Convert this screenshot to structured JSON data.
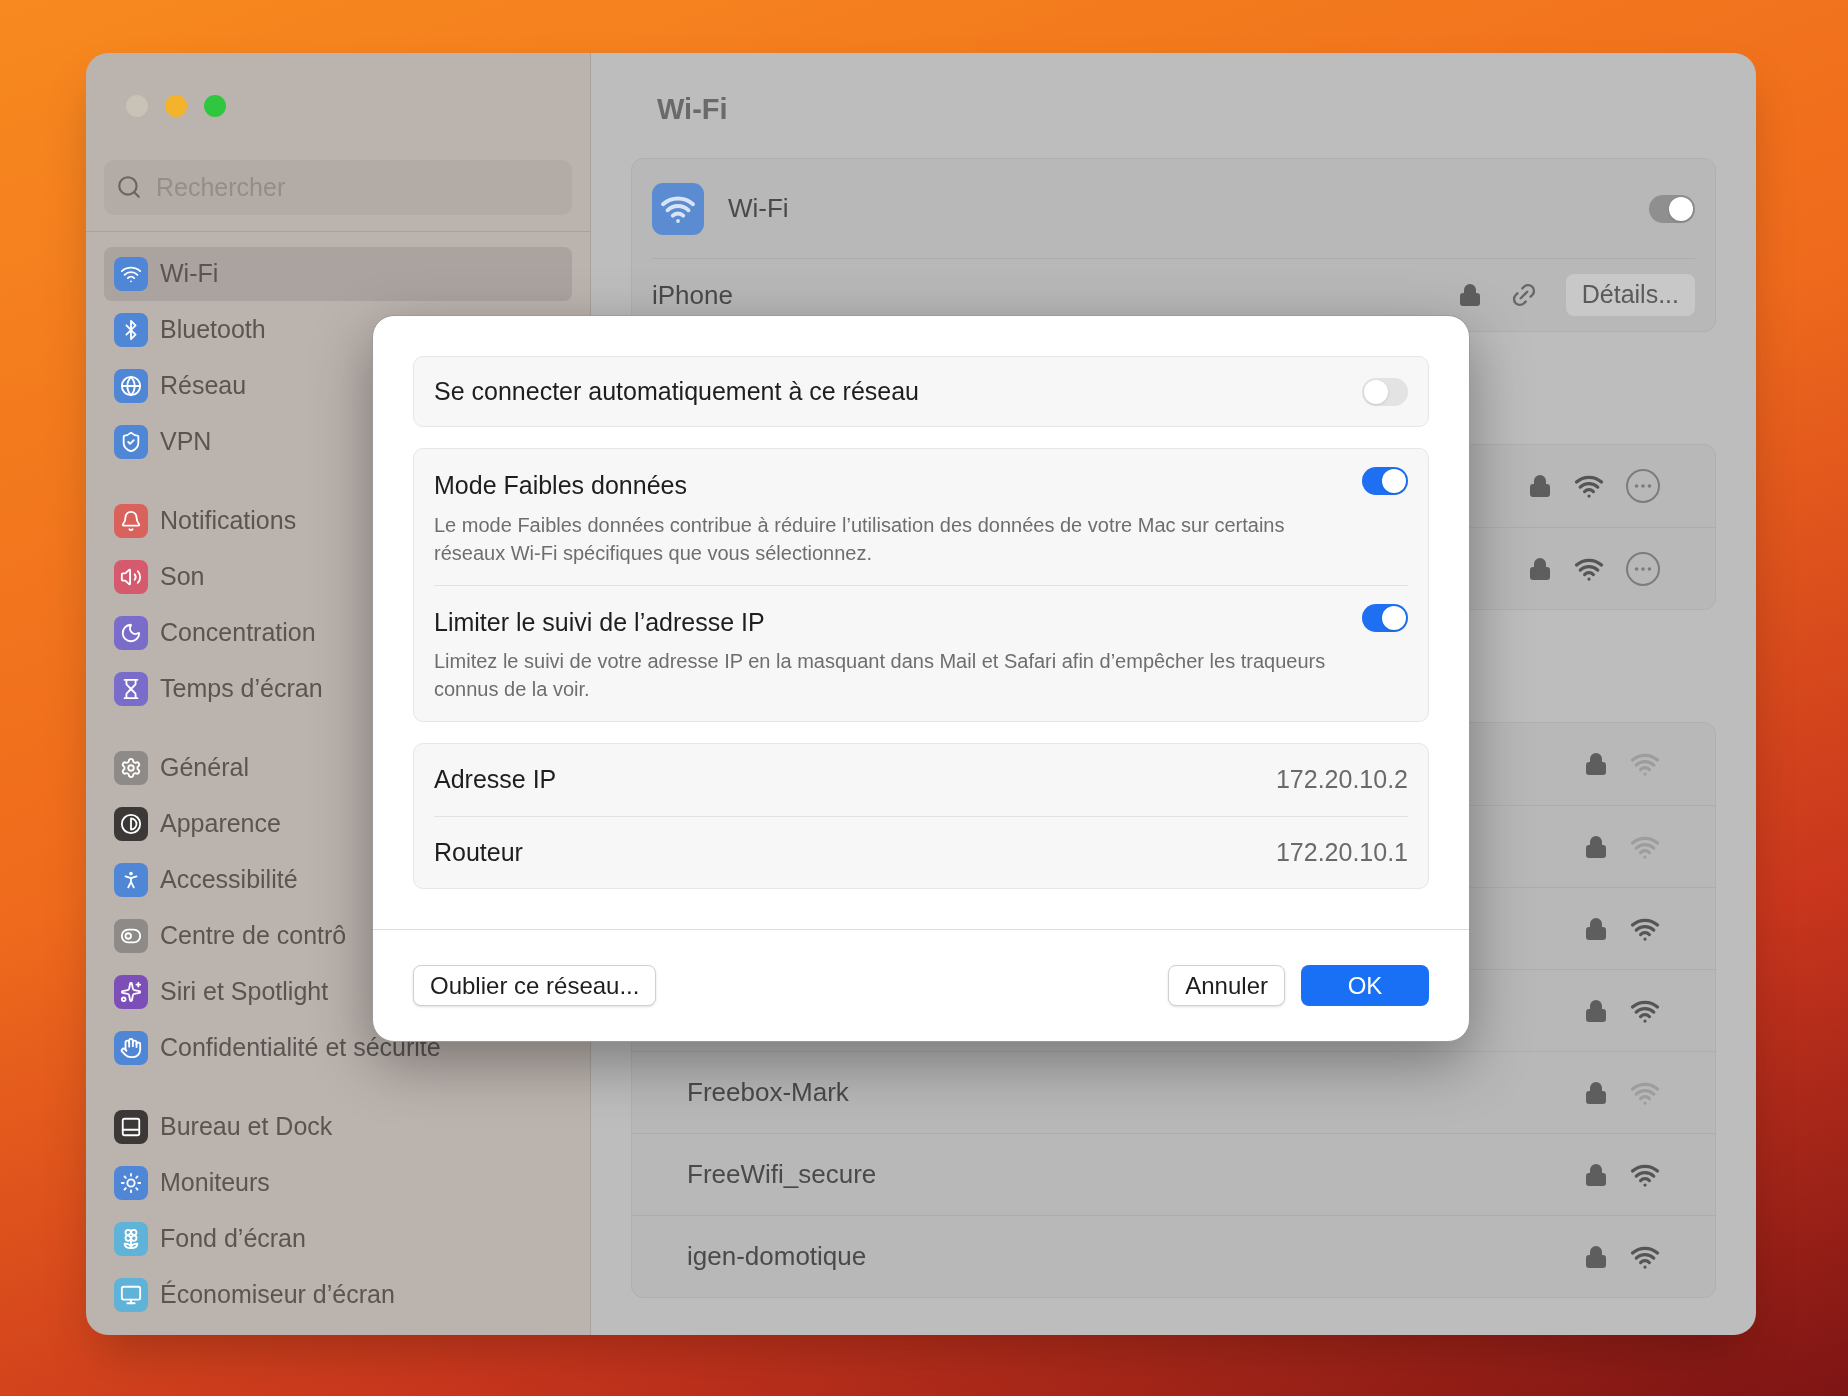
{
  "window": {
    "controls": [
      {
        "kind": "close"
      },
      {
        "kind": "minimize"
      },
      {
        "kind": "zoom"
      }
    ]
  },
  "sidebar": {
    "search": {
      "placeholder": "Rechercher"
    },
    "groups": [
      {
        "items": [
          {
            "label": "Wi-Fi",
            "selected": true
          },
          {
            "label": "Bluetooth",
            "selected": false
          },
          {
            "label": "Réseau",
            "selected": false
          },
          {
            "label": "VPN",
            "selected": false
          }
        ]
      },
      {
        "items": [
          {
            "label": "Notifications",
            "selected": false
          },
          {
            "label": "Son",
            "selected": false
          },
          {
            "label": "Concentration",
            "selected": false
          },
          {
            "label": "Temps d’écran",
            "selected": false
          }
        ]
      },
      {
        "items": [
          {
            "label": "Général",
            "selected": false
          },
          {
            "label": "Apparence",
            "selected": false
          },
          {
            "label": "Accessibilité",
            "selected": false
          },
          {
            "label": "Centre de contrô",
            "selected": false
          },
          {
            "label": "Siri et Spotlight",
            "selected": false
          },
          {
            "label": "Confidentialité et sécurité",
            "selected": false
          }
        ]
      },
      {
        "items": [
          {
            "label": "Bureau et Dock",
            "selected": false
          },
          {
            "label": "Moniteurs",
            "selected": false
          },
          {
            "label": "Fond d’écran",
            "selected": false
          },
          {
            "label": "Économiseur d’écran",
            "selected": false
          }
        ]
      }
    ]
  },
  "content": {
    "title": "Wi-Fi",
    "wifi_card": {
      "label": "Wi-Fi",
      "on": true,
      "current": {
        "name": "iPhone",
        "button": "Détails..."
      }
    },
    "known_networks": [
      {
        "weak": false
      },
      {
        "weak": false
      }
    ],
    "other_networks": [
      {
        "weak": true
      },
      {
        "weak": true
      },
      {
        "weak": false
      },
      {
        "weak": false
      },
      {
        "name": "Freebox-Mark",
        "weak": true
      },
      {
        "name": "FreeWifi_secure",
        "weak": false
      },
      {
        "name": "igen-domotique",
        "weak": false
      }
    ]
  },
  "dialog": {
    "auto_connect": {
      "label": "Se connecter automatiquement à ce réseau",
      "on": false
    },
    "options": [
      {
        "title": "Mode Faibles données",
        "description": "Le mode Faibles données contribue à réduire l’utilisation des données de votre Mac sur certains réseaux Wi-Fi spécifiques que vous sélectionnez.",
        "on": true
      },
      {
        "title": "Limiter le suivi de l’adresse IP",
        "description": "Limitez le suivi de votre adresse IP en la masquant dans Mail et Safari afin d’empêcher les traqueurs connus de la voir.",
        "on": true
      }
    ],
    "info": [
      {
        "label": "Adresse IP",
        "value": "172.20.10.2"
      },
      {
        "label": "Routeur",
        "value": "172.20.10.1"
      }
    ],
    "buttons": {
      "forget": "Oublier ce réseau...",
      "cancel": "Annuler",
      "ok": "OK"
    }
  }
}
